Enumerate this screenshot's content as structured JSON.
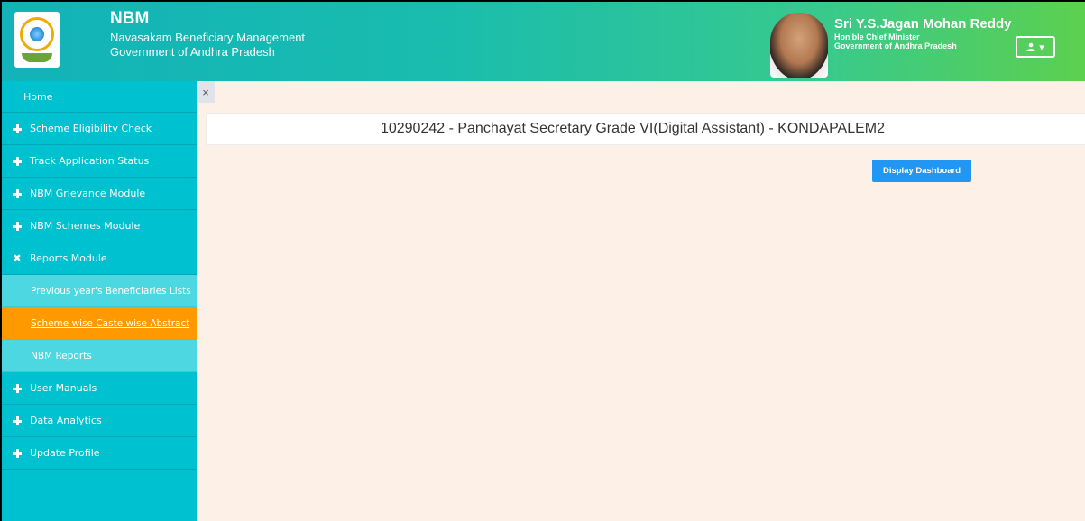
{
  "header": {
    "app_short": "NBM",
    "app_full": "Navasakam Beneficiary Management",
    "gov": "Government of Andhra Pradesh",
    "cm_name": "Sri Y.S.Jagan Mohan Reddy",
    "cm_title": "Hon'ble Chief Minister",
    "cm_gov": "Government of Andhra Pradesh",
    "user_menu_icon": "user-icon",
    "user_menu_caret": "▾"
  },
  "sidebar": {
    "home": "Home",
    "items": [
      {
        "label": "Scheme Eligibility Check",
        "icon": "plus"
      },
      {
        "label": "Track Application Status",
        "icon": "plus"
      },
      {
        "label": "NBM Grievance Module",
        "icon": "plus"
      },
      {
        "label": "NBM Schemes Module",
        "icon": "plus"
      },
      {
        "label": "Reports Module",
        "icon": "close"
      }
    ],
    "sub_items": [
      {
        "label": "Previous year's Beneficiaries Lists"
      },
      {
        "label": "Scheme wise Caste wise Abstract"
      },
      {
        "label": "NBM Reports"
      }
    ],
    "items_after": [
      {
        "label": "User Manuals",
        "icon": "plus"
      },
      {
        "label": "Data Analytics",
        "icon": "plus"
      },
      {
        "label": "Update Profile",
        "icon": "plus"
      }
    ],
    "collapse": "×"
  },
  "main": {
    "title": "10290242 - Panchayat Secretary Grade VI(Digital Assistant) - KONDAPALEM2",
    "dashboard_button": "Display Dashboard"
  },
  "colors": {
    "sidebar": "#00c1cf",
    "submenu": "#4dd8e1",
    "active": "#ff9900",
    "content_bg": "#fdf1e7",
    "button": "#2196f3"
  }
}
